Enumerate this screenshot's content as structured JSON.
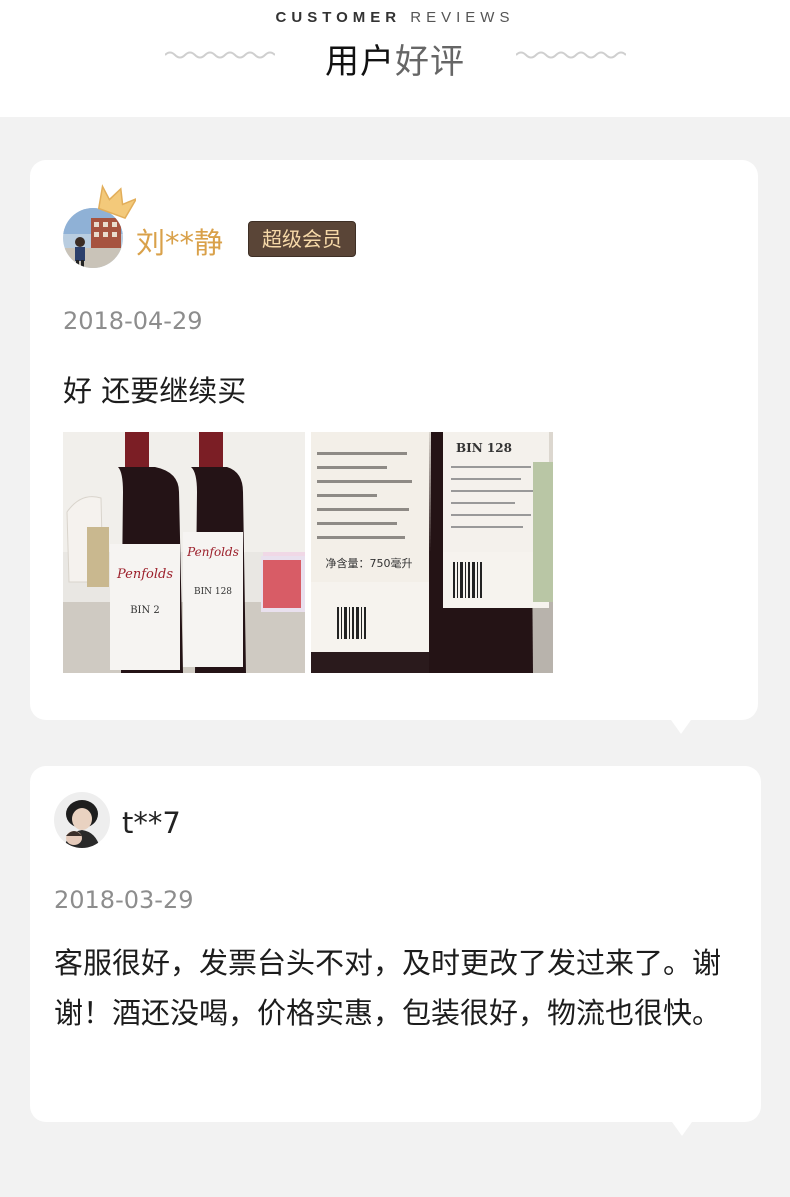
{
  "header": {
    "en_bold": "CUSTOMER",
    "en_light": "REVIEWS",
    "cn_dark": "用户",
    "cn_light": "好评"
  },
  "reviews": [
    {
      "username": "刘**静",
      "badge": "超级会员",
      "date": "2018-04-29",
      "text": "好 还要继续买",
      "photo1": {
        "bottle1_brand": "Penfolds",
        "bottle1_bin": "BIN 2",
        "bottle2_brand": "Penfolds",
        "bottle2_bin": "BIN 128"
      },
      "photo2": {
        "label_bin": "BIN 128",
        "volume": "净含量：750毫升"
      }
    },
    {
      "username": "t**7",
      "date": "2018-03-29",
      "text": "客服很好，发票台头不对，及时更改了发过来了。谢谢！酒还没喝，价格实惠，包装很好，物流也很快。"
    }
  ],
  "colors": {
    "vip_name": "#d9a14a",
    "badge_bg": "#5a4537",
    "badge_text": "#f6d9a8",
    "page_bg": "#f2f2f2"
  }
}
